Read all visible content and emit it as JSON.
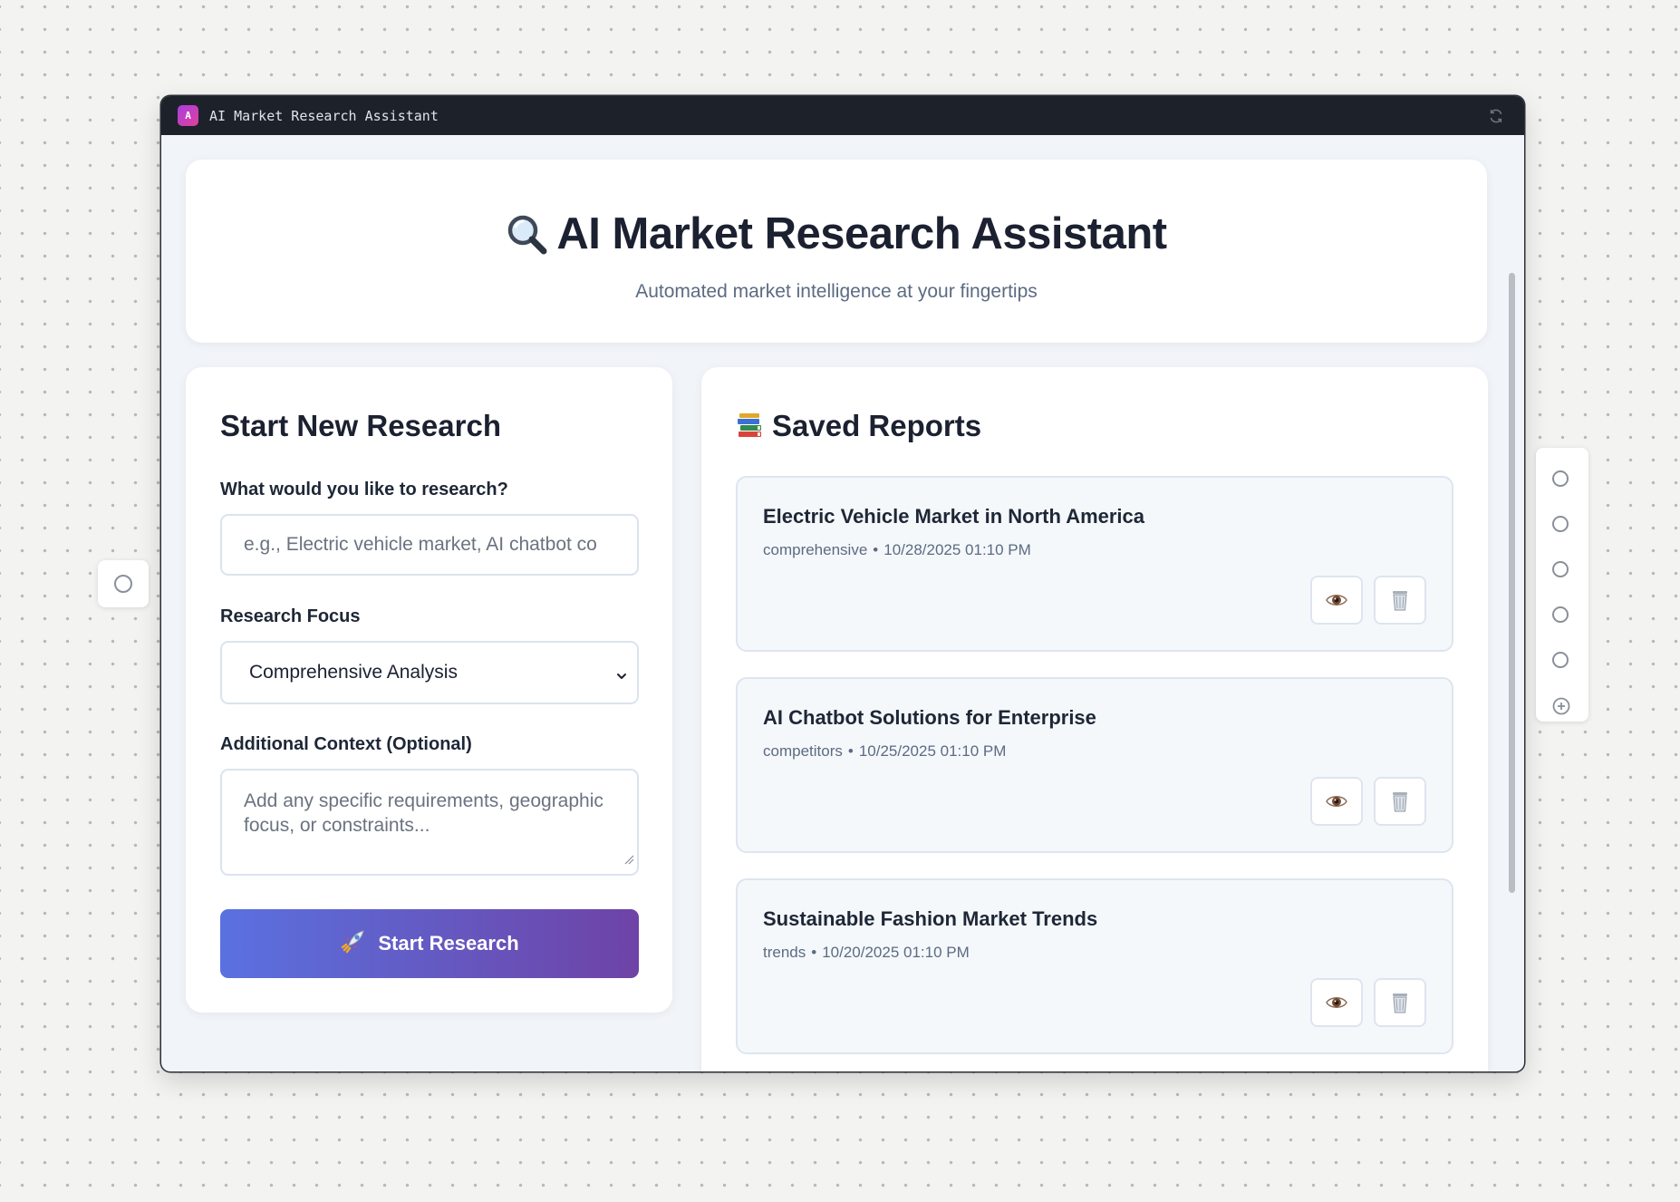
{
  "window": {
    "title": "AI Market Research Assistant",
    "badge": "A"
  },
  "header": {
    "title": "AI Market Research Assistant",
    "subtitle": "Automated market intelligence at your fingertips"
  },
  "form": {
    "title": "Start New Research",
    "topic_label": "What would you like to research?",
    "topic_placeholder": "e.g., Electric vehicle market, AI chatbot co",
    "focus_label": "Research Focus",
    "focus_value": "Comprehensive Analysis",
    "context_label": "Additional Context (Optional)",
    "context_placeholder": "Add any specific requirements, geographic focus, or constraints...",
    "submit_label": "Start Research"
  },
  "reports": {
    "title": "Saved Reports",
    "items": [
      {
        "title": "Electric Vehicle Market in North America",
        "type": "comprehensive",
        "date": "10/28/2025 01:10 PM"
      },
      {
        "title": "AI Chatbot Solutions for Enterprise",
        "type": "competitors",
        "date": "10/25/2025 01:10 PM"
      },
      {
        "title": "Sustainable Fashion Market Trends",
        "type": "trends",
        "date": "10/20/2025 01:10 PM"
      }
    ]
  },
  "icons": {
    "header": "magnifier-icon",
    "reports": "books-icon",
    "submit": "rocket-icon",
    "view": "eye-icon",
    "delete": "trash-icon",
    "titlebar": "refresh-icon"
  },
  "colors": {
    "accent_start": "#5a71e0",
    "accent_end": "#6e43a6",
    "titlebar": "#1d2129"
  }
}
